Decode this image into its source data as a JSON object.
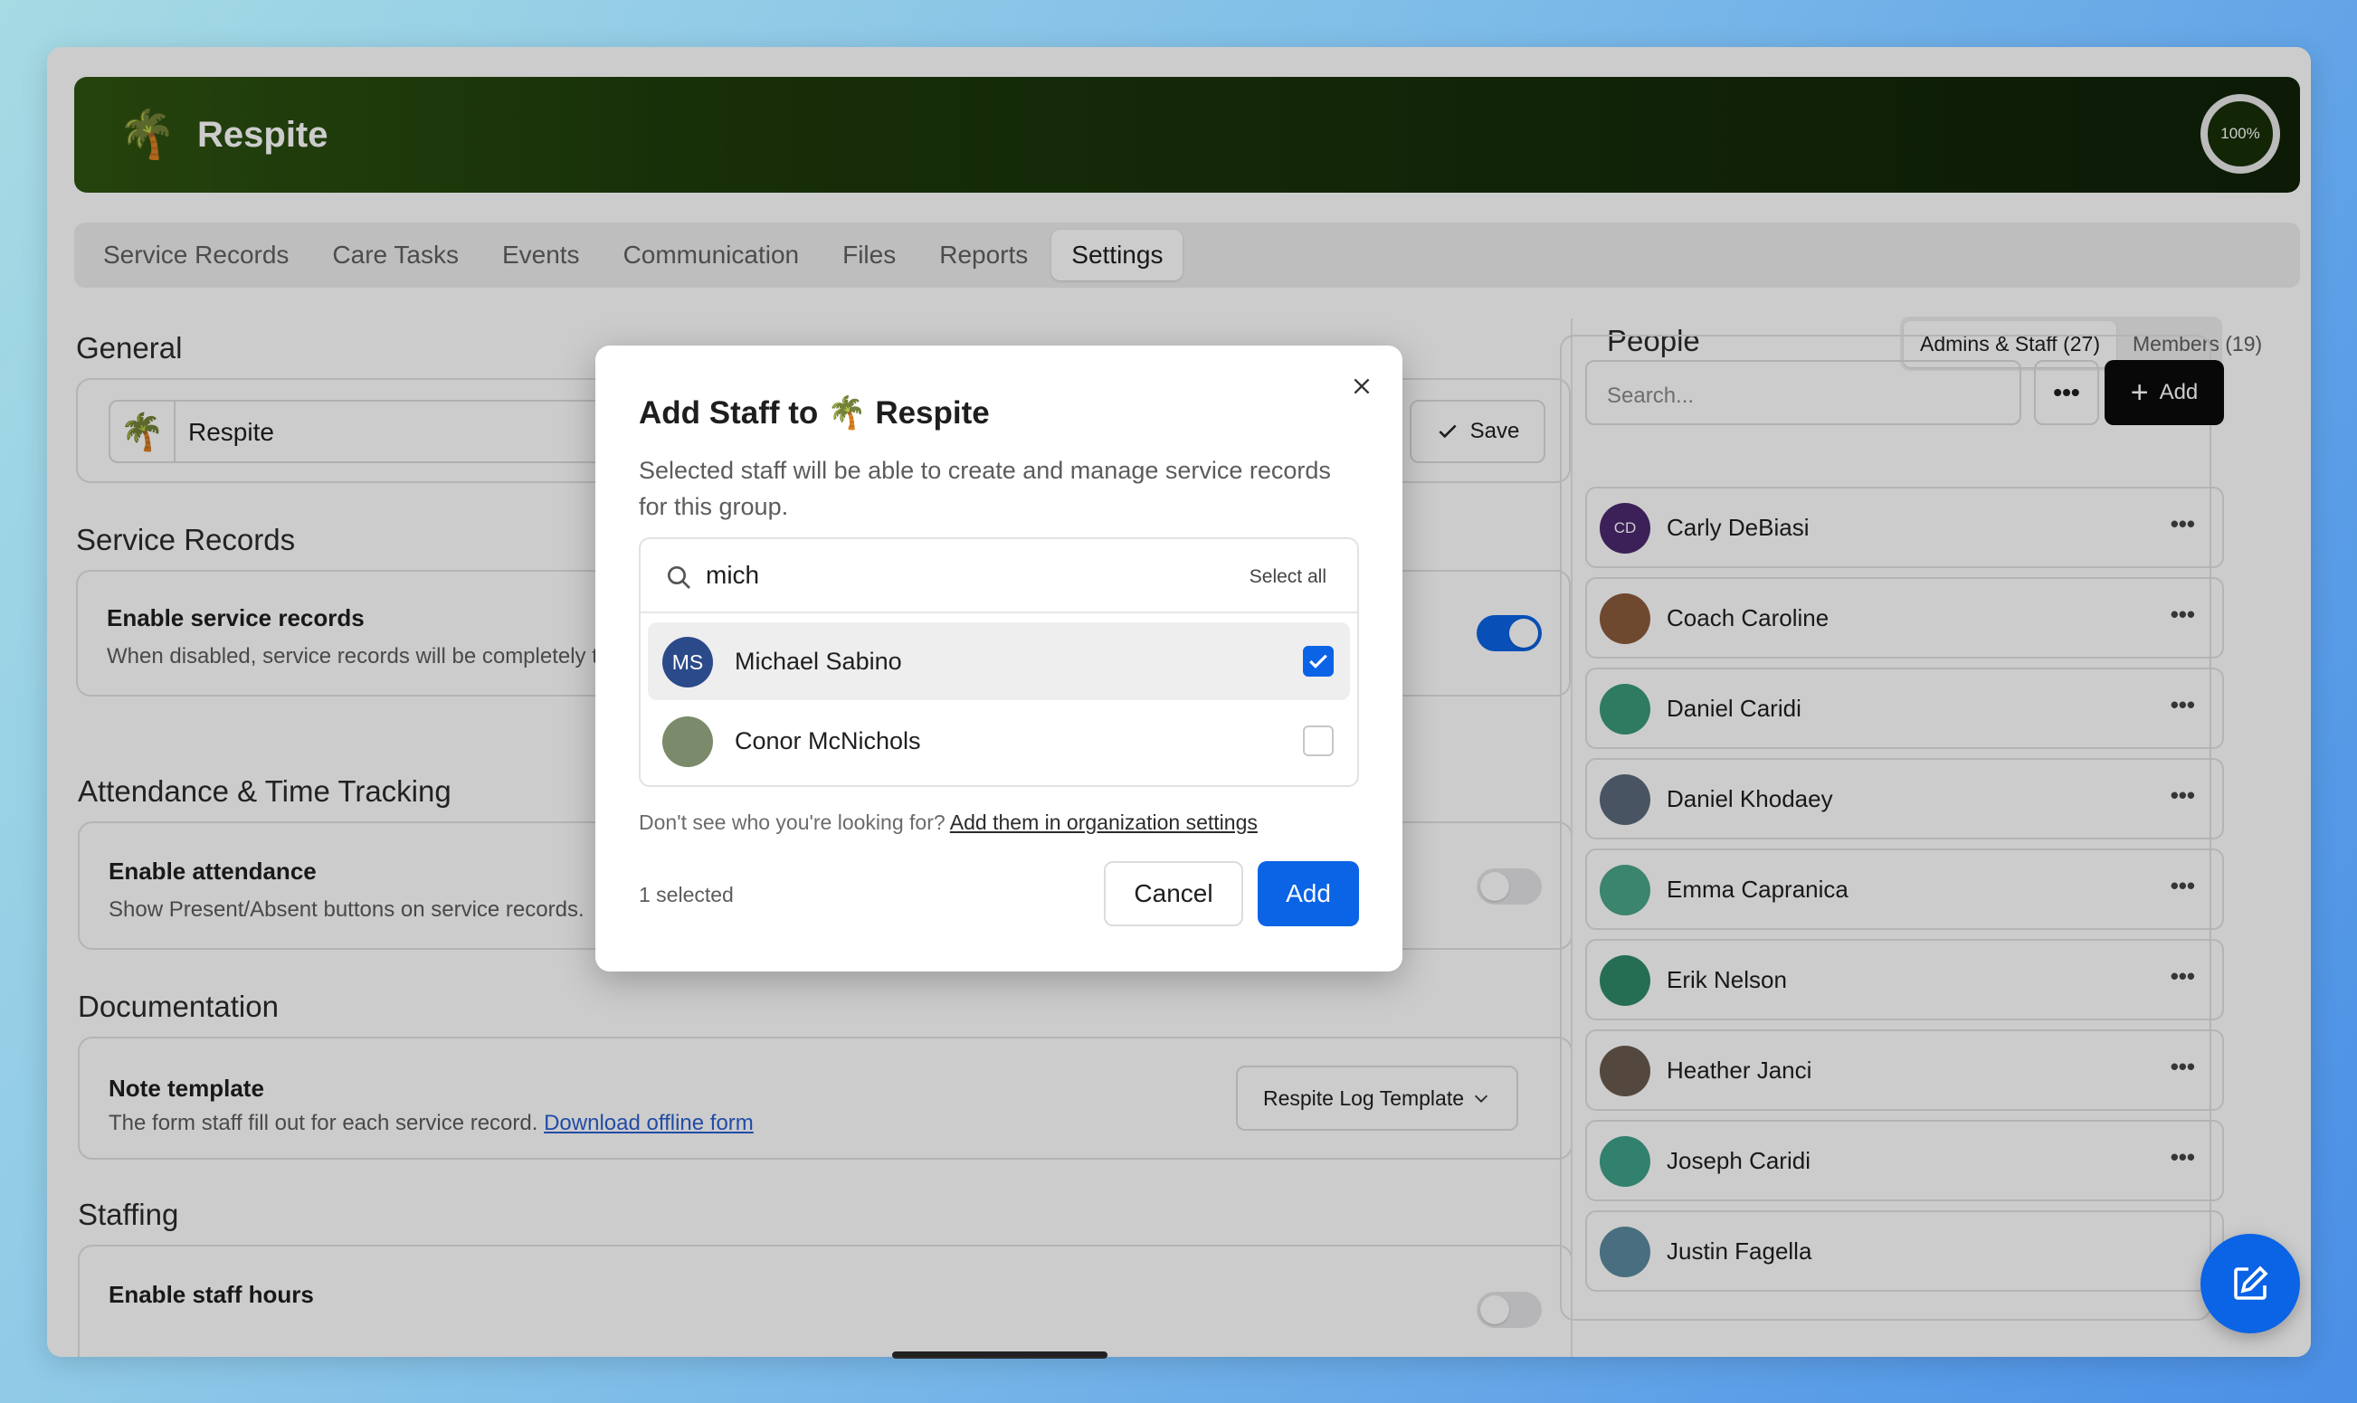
{
  "app": {
    "title": "Respite",
    "emoji": "🌴",
    "progress": "100%",
    "progress_value": 100,
    "accent_color": "#0b63e5",
    "header_color": "#1d3a0b"
  },
  "tabs": [
    {
      "label": "Service Records",
      "active": false
    },
    {
      "label": "Care Tasks",
      "active": false
    },
    {
      "label": "Events",
      "active": false
    },
    {
      "label": "Communication",
      "active": false
    },
    {
      "label": "Files",
      "active": false
    },
    {
      "label": "Reports",
      "active": false
    },
    {
      "label": "Settings",
      "active": true
    }
  ],
  "general": {
    "title": "General",
    "name_value": "Respite",
    "save_label": "Save"
  },
  "service_records": {
    "title": "Service Records",
    "toggle_title": "Enable service records",
    "toggle_desc": "When disabled, service records will be completely t",
    "enabled": true
  },
  "attendance": {
    "title": "Attendance & Time Tracking",
    "toggle_title": "Enable attendance",
    "toggle_desc": "Show Present/Absent buttons on service records.",
    "enabled": false
  },
  "documentation": {
    "title": "Documentation",
    "note_title": "Note template",
    "note_desc": "The form staff fill out for each service record.",
    "note_link": "Download offline form",
    "template_value": "Respite Log Template"
  },
  "staffing": {
    "title": "Staffing",
    "toggle_title": "Enable staff hours",
    "enabled": false
  },
  "people": {
    "title": "People",
    "tab_staff": "Admins & Staff (27)",
    "tab_members": "Members (19)",
    "search_placeholder": "Search...",
    "add_label": "Add",
    "list": [
      {
        "name": "Carly DeBiasi",
        "initials": "CD",
        "color": "#4a2a6e"
      },
      {
        "name": "Coach Caroline",
        "initials": "",
        "color": "#8b5a3c"
      },
      {
        "name": "Daniel Caridi",
        "initials": "",
        "color": "#3a9a7a"
      },
      {
        "name": "Daniel Khodaey",
        "initials": "",
        "color": "#5a6a7a"
      },
      {
        "name": "Emma Capranica",
        "initials": "",
        "color": "#4aa58a"
      },
      {
        "name": "Erik Nelson",
        "initials": "",
        "color": "#2f8a6a"
      },
      {
        "name": "Heather Janci",
        "initials": "",
        "color": "#6a5a4e"
      },
      {
        "name": "Joseph Caridi",
        "initials": "",
        "color": "#3fa08a"
      },
      {
        "name": "Justin Fagella",
        "initials": "",
        "color": "#5a8aa0"
      }
    ]
  },
  "modal": {
    "title": "Add Staff to 🌴 Respite",
    "description": "Selected staff will be able to create and manage service records for this group.",
    "search_value": "mich",
    "select_all": "Select all",
    "results": [
      {
        "name": "Michael Sabino",
        "initials": "MS",
        "selected": true
      },
      {
        "name": "Conor McNichols",
        "initials": "",
        "selected": false
      }
    ],
    "hint_text": "Don't see who you're looking for?",
    "hint_link": "Add them in organization settings",
    "selected_count": "1 selected",
    "cancel_label": "Cancel",
    "add_label": "Add"
  }
}
